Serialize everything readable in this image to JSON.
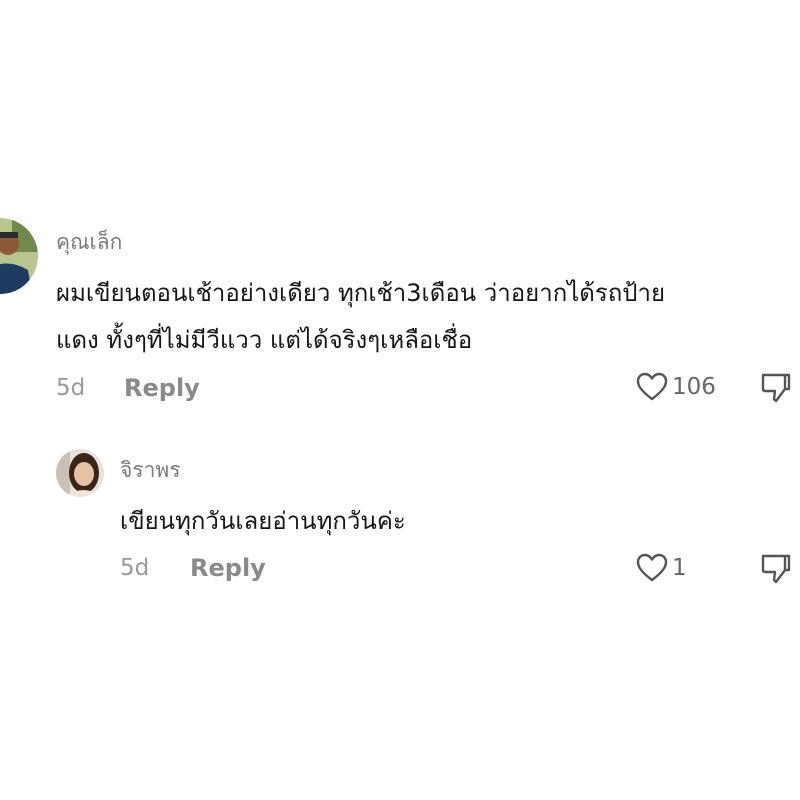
{
  "comment": {
    "username": "คุณเล็ก",
    "text_line_1": "ผมเขียนตอนเช้าอย่างเดียว ทุกเช้า3เดือน ว่าอยากได้รถป้าย",
    "text_line_2": "แดง ทั้งๆที่ไม่มีวีแวว แต่ได้จริงๆเหลือเชื่อ",
    "time": "5d",
    "reply_label": "Reply",
    "like_count": "106",
    "avatar_icon": "user-avatar-photo",
    "like_icon": "heart-outline-icon",
    "dislike_icon": "thumb-down-icon"
  },
  "reply": {
    "username": "จิราพร",
    "text": "เขียนทุกวันเลยอ่านทุกวันค่ะ",
    "time": "5d",
    "reply_label": "Reply",
    "like_count": "1",
    "avatar_icon": "user-avatar-photo",
    "like_icon": "heart-outline-icon",
    "dislike_icon": "thumb-down-icon"
  },
  "colors": {
    "username": "#7a7a7a",
    "text": "#161616",
    "meta": "#9a9a9a",
    "icon": "#555555"
  }
}
